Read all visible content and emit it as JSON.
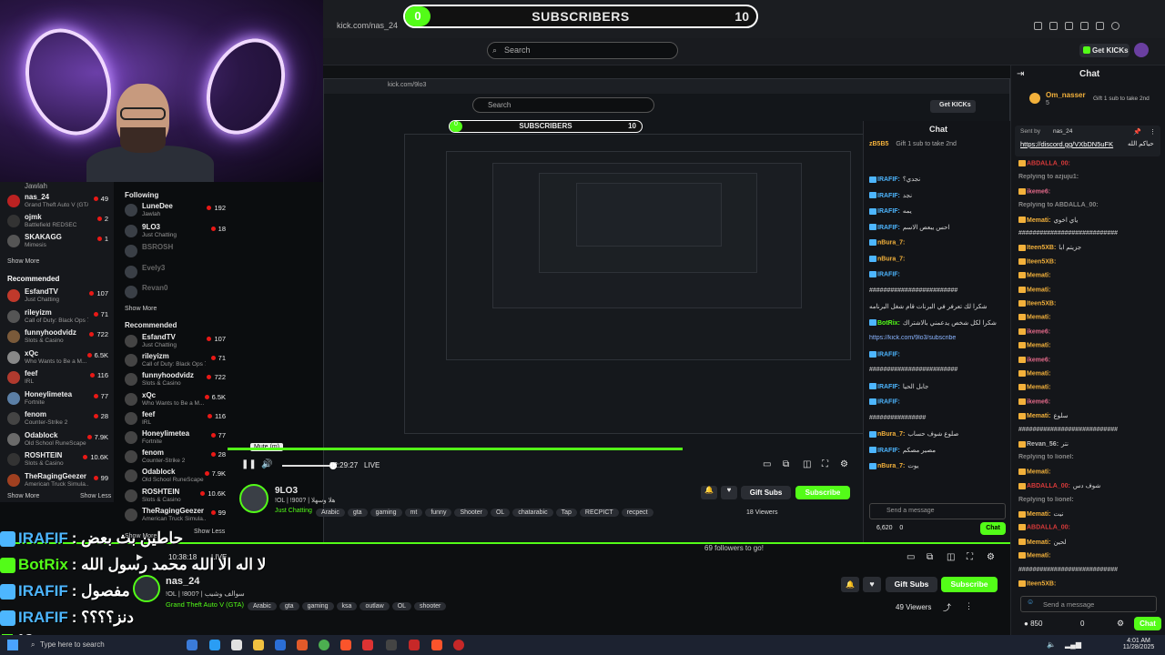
{
  "browser": {
    "address": "kick.com/nas_24",
    "search_placeholder": "Search",
    "get_kicks": "Get KICKs"
  },
  "subs_goal": {
    "current": "0",
    "label": "SUBSCRIBERS",
    "goal": "10"
  },
  "sidebar": {
    "following_top": [
      {
        "name": "Jawlah",
        "sub": "",
        "viewers": ""
      },
      {
        "name": "nas_24",
        "sub": "Grand Theft Auto V (GTA)",
        "viewers": "49"
      },
      {
        "name": "ojmk",
        "sub": "Battlefield REDSEC",
        "viewers": "2"
      },
      {
        "name": "SKAKAGG",
        "sub": "Mimesis",
        "viewers": "1"
      }
    ],
    "show_more": "Show More",
    "show_less": "Show Less",
    "recommended_header": "Recommended",
    "recommended": [
      {
        "name": "EsfandTV",
        "sub": "Just Chatting",
        "viewers": "107",
        "color": "#c0392b"
      },
      {
        "name": "rileyizm",
        "sub": "Call of Duty: Black Ops 7",
        "viewers": "71",
        "color": "#555"
      },
      {
        "name": "funnyhoodvidz",
        "sub": "Slots & Casino",
        "viewers": "722",
        "color": "#7a5a3a"
      },
      {
        "name": "xQc",
        "sub": "Who Wants to Be a M...",
        "viewers": "6.5K",
        "color": "#888"
      },
      {
        "name": "feef",
        "sub": "IRL",
        "viewers": "116",
        "color": "#b03a2e"
      },
      {
        "name": "Honeylimetea",
        "sub": "Fortnite",
        "viewers": "77",
        "color": "#5b7fa6"
      },
      {
        "name": "fenom",
        "sub": "Counter-Strike 2",
        "viewers": "28",
        "color": "#444"
      },
      {
        "name": "Odablock",
        "sub": "Old School RuneScape",
        "viewers": "7.9K",
        "color": "#6a6a6a"
      },
      {
        "name": "ROSHTEIN",
        "sub": "Slots & Casino",
        "viewers": "10.6K",
        "color": "#333"
      },
      {
        "name": "TheRagingGeezer",
        "sub": "American Truck Simula...",
        "viewers": "99",
        "color": "#a04020"
      }
    ]
  },
  "nested": {
    "following_header": "Following",
    "following": [
      {
        "name": "LuneDee",
        "sub": "Jawlah",
        "viewers": "192"
      },
      {
        "name": "9LO3",
        "sub": "Just Chatting",
        "viewers": "18"
      },
      {
        "name": "BSROSH",
        "sub": "",
        "viewers": ""
      },
      {
        "name": "Evely3",
        "sub": "",
        "viewers": ""
      },
      {
        "name": "Revan0",
        "sub": "",
        "viewers": ""
      }
    ],
    "show_more": "Show More",
    "recommended_header": "Recommended",
    "recommended": [
      {
        "name": "EsfandTV",
        "sub": "Just Chatting",
        "viewers": "107"
      },
      {
        "name": "rileyizm",
        "sub": "Call of Duty: Black Ops 7",
        "viewers": "71"
      },
      {
        "name": "funnyhoodvidz",
        "sub": "Slots & Casino",
        "viewers": "722"
      },
      {
        "name": "xQc",
        "sub": "Who Wants to Be a M...",
        "viewers": "6.5K"
      },
      {
        "name": "feef",
        "sub": "IRL",
        "viewers": "116"
      },
      {
        "name": "Honeylimetea",
        "sub": "Fortnite",
        "viewers": "77"
      },
      {
        "name": "fenom",
        "sub": "Counter-Strike 2",
        "viewers": "28"
      },
      {
        "name": "Odablock",
        "sub": "Old School RuneScape",
        "viewers": "7.9K"
      },
      {
        "name": "ROSHTEIN",
        "sub": "Slots & Casino",
        "viewers": "10.6K"
      },
      {
        "name": "TheRagingGeezer",
        "sub": "American Truck Simula...",
        "viewers": "99"
      }
    ],
    "show_more_bottom": "Show More",
    "show_less": "Show Less",
    "channel": "9LO3",
    "title": "!OL | !900? | هلا وسهلا",
    "category": "Just Chatting",
    "tags": [
      "Arabic",
      "gta",
      "gaming",
      "mt",
      "funny",
      "Shooter",
      "OL",
      "chatarabic",
      "Tap",
      "RECPICT",
      "recpect"
    ],
    "viewers": "18 Viewers",
    "gift_subs": "Gift Subs",
    "subscribe": "Subscribe",
    "time": "02:29:27",
    "live": "LIVE",
    "mute_tooltip": "Mute (m)",
    "followers_goal": "69 followers to go!",
    "chat_title": "Chat",
    "chat_header_user": "zB5B5",
    "chat_header_text": "Gift 1 sub to take 2nd",
    "send_placeholder": "Send a message",
    "points": "6,620",
    "points_zero": "0",
    "chat_btn": "Chat",
    "messages": [
      {
        "user": "IRAFIF:",
        "text": "نجدي؟",
        "color": "#4db6ff"
      },
      {
        "user": "IRAFIF:",
        "text": "نجد",
        "color": "#4db6ff"
      },
      {
        "user": "IRAFIF:",
        "text": "يمه",
        "color": "#4db6ff"
      },
      {
        "user": "IRAFIF:",
        "text": "احس يبعص الاسم",
        "color": "#4db6ff"
      },
      {
        "user": "nBura_7:",
        "text": "",
        "color": "#f3b13b"
      },
      {
        "user": "nBura_7:",
        "text": "",
        "color": "#f3b13b"
      },
      {
        "user": "IRAFIF:",
        "text": "",
        "color": "#4db6ff"
      },
      {
        "user": "",
        "text": "#########################",
        "color": "#ddd"
      },
      {
        "user": "",
        "text": "شكرا لك تعرفر في البرنات قام شغل البرنامه",
        "color": "#ddd"
      },
      {
        "user": "BotRix:",
        "text": "شكرا لكل شخص يدعمني بالاشتراك",
        "color": "#53fc18"
      },
      {
        "user": "",
        "text": "https://kick.com/9lo3/subscribe",
        "color": "#8ab4ff"
      },
      {
        "user": "IRAFIF:",
        "text": "",
        "color": "#4db6ff"
      },
      {
        "user": "",
        "text": "#########################",
        "color": "#ddd"
      },
      {
        "user": "IRAFIF:",
        "text": "جابل الحيا",
        "color": "#4db6ff"
      },
      {
        "user": "IRAFIF:",
        "text": "",
        "color": "#4db6ff"
      },
      {
        "user": "",
        "text": "################",
        "color": "#ddd"
      },
      {
        "user": "nBura_7:",
        "text": "صلوع شوف حساب",
        "color": "#f3b13b"
      },
      {
        "user": "IRAFIF:",
        "text": "مصير مصكم",
        "color": "#4db6ff"
      },
      {
        "user": "nBura_7:",
        "text": "يوت",
        "color": "#f3b13b"
      }
    ]
  },
  "main_channel": {
    "name": "nas_24",
    "title": "!OL | !800? | سوالف وشيب",
    "category": "Grand Theft Auto V (GTA)",
    "tags": [
      "Arabic",
      "gta",
      "gaming",
      "ksa",
      "outlaw",
      "OL",
      "shooter"
    ],
    "viewers": "49 Viewers",
    "gift_subs": "Gift Subs",
    "subscribe": "Subscribe",
    "time": "10:38:18",
    "live": "LIVE",
    "followers_goal": "69 followers to go!"
  },
  "chat": {
    "title": "Chat",
    "top_user": "Om_nasser",
    "top_user_level": "5",
    "top_text": "Gift 1 sub to take 2nd",
    "pinned_by_label": "Sent by",
    "pinned_by": "nas_24",
    "pinned_link": "https://discord.gg/VXbDN5uFK",
    "pinned_suffix": "حياكم الله",
    "messages": [
      {
        "user": "ABDALLA_00:",
        "text": "",
        "color": "#d93a3a"
      },
      {
        "user": "Replying to azjuju1:",
        "text": "",
        "color": "#888"
      },
      {
        "user": "ikeme6:",
        "text": "",
        "color": "#e36a8a"
      },
      {
        "user": "Replying to ABDALLA_00:",
        "text": "",
        "color": "#888"
      },
      {
        "user": "Memati:",
        "text": "ياي اخوي",
        "color": "#f3b13b"
      },
      {
        "user": "",
        "text": "############################",
        "color": "#ddd"
      },
      {
        "user": "Iteen5XB:",
        "text": "جزيتم ابا",
        "color": "#f3b13b"
      },
      {
        "user": "Iteen5XB:",
        "text": "",
        "color": "#f3b13b"
      },
      {
        "user": "Memati:",
        "text": "",
        "color": "#f3b13b"
      },
      {
        "user": "Memati:",
        "text": "",
        "color": "#f3b13b"
      },
      {
        "user": "Iteen5XB:",
        "text": "",
        "color": "#f3b13b"
      },
      {
        "user": "Memati:",
        "text": "",
        "color": "#f3b13b"
      },
      {
        "user": "ikeme6:",
        "text": "",
        "color": "#e36a8a"
      },
      {
        "user": "Memati:",
        "text": "",
        "color": "#f3b13b"
      },
      {
        "user": "ikeme6:",
        "text": "",
        "color": "#e36a8a"
      },
      {
        "user": "Memati:",
        "text": "",
        "color": "#f3b13b"
      },
      {
        "user": "Memati:",
        "text": "",
        "color": "#f3b13b"
      },
      {
        "user": "ikeme6:",
        "text": "",
        "color": "#e36a8a"
      },
      {
        "user": "Memati:",
        "text": "سلوع",
        "color": "#f3b13b"
      },
      {
        "user": "",
        "text": "############################",
        "color": "#ddd"
      },
      {
        "user": "Revan_56:",
        "text": "نتر",
        "color": "#bbb"
      },
      {
        "user": "Replying to lionel:",
        "text": "",
        "color": "#888"
      },
      {
        "user": "Memati:",
        "text": "",
        "color": "#f3b13b"
      },
      {
        "user": "ABDALLA_00:",
        "text": "شوف دس",
        "color": "#d93a3a"
      },
      {
        "user": "Replying to lionel:",
        "text": "",
        "color": "#888"
      },
      {
        "user": "Memati:",
        "text": "نيت",
        "color": "#f3b13b"
      },
      {
        "user": "ABDALLA_00:",
        "text": "",
        "color": "#d93a3a"
      },
      {
        "user": "Memati:",
        "text": "لحين",
        "color": "#f3b13b"
      },
      {
        "user": "Memati:",
        "text": "",
        "color": "#f3b13b"
      },
      {
        "user": "",
        "text": "############################",
        "color": "#ddd"
      },
      {
        "user": "Iteen5XB:",
        "text": "",
        "color": "#f3b13b"
      }
    ],
    "send_placeholder": "Send a message",
    "points": "850",
    "points_zero": "0",
    "chat_btn": "Chat"
  },
  "overlay": {
    "messages": [
      {
        "user": "IRAFIF",
        "text": ": حاطين بث بعض",
        "color": "#4db6ff"
      },
      {
        "user": "BotRix",
        "text": ": لا اله الا الله محمد رسول الله",
        "color": "#53fc18"
      },
      {
        "user": "IRAFIF",
        "text": ": مفصول",
        "color": "#4db6ff"
      },
      {
        "user": "IRAFIF",
        "text": ": دنز؟؟؟؟",
        "color": "#4db6ff"
      }
    ],
    "viewer_count": "18"
  },
  "taskbar": {
    "search_placeholder": "Type here to search",
    "time": "4:01 AM",
    "date": "11/28/2025"
  }
}
